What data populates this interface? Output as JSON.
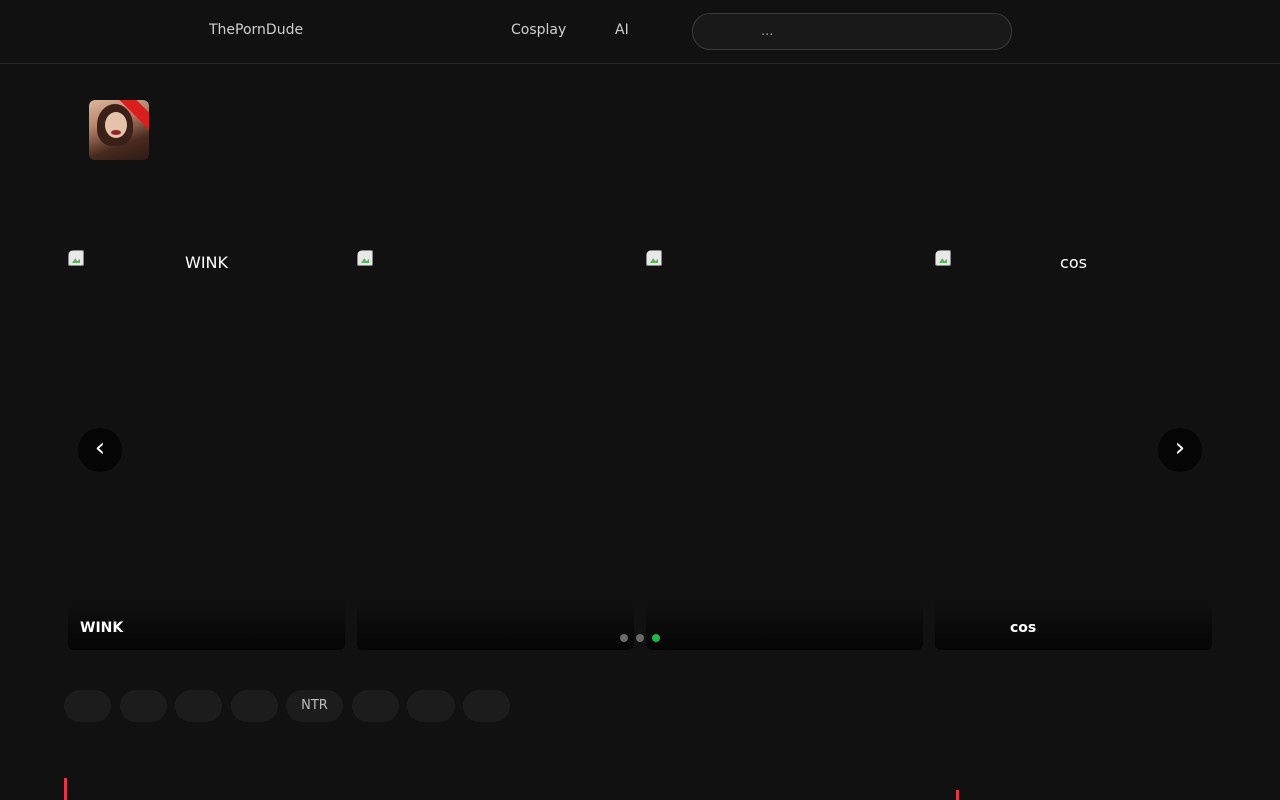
{
  "header": {
    "brand": "ThePornDude",
    "nav": [
      {
        "label": "Cosplay"
      },
      {
        "label": "AI"
      }
    ],
    "search": {
      "placeholder": "...",
      "value": ""
    }
  },
  "avatar": {
    "icon": "avatar-image"
  },
  "carousel": {
    "slides": [
      {
        "alt": "WINK",
        "caption": "WINK"
      },
      {
        "alt": "",
        "caption": ""
      },
      {
        "alt": "",
        "caption": ""
      },
      {
        "alt": "cos",
        "caption": "cos"
      }
    ],
    "prev_label": "‹",
    "next_label": "›",
    "active_index": 3,
    "dot_count": 3
  },
  "tags": [
    {
      "label": ""
    },
    {
      "label": ""
    },
    {
      "label": ""
    },
    {
      "label": ""
    },
    {
      "label": "NTR"
    },
    {
      "label": ""
    },
    {
      "label": ""
    },
    {
      "label": ""
    }
  ],
  "colors": {
    "background": "#111111",
    "accent": "#e2364a",
    "active_dot": "#1db94a"
  }
}
